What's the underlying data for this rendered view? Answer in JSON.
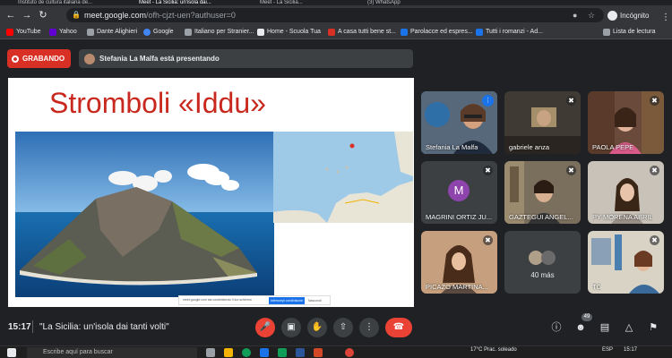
{
  "browser": {
    "tabs": [
      "Instituto de cultura italiana de...",
      "Meet - La Sicilia: un'isola dai...",
      "Meet - La Sicilia...",
      "(3) WhatsApp"
    ],
    "url_host": "meet.google.com",
    "url_path": "/ofh-cjzt-uen?authuser=0",
    "incognito_label": "Incógnito",
    "bookmarks": [
      {
        "label": "YouTube",
        "color": "#ff0000"
      },
      {
        "label": "Yahoo",
        "color": "#6001d2"
      },
      {
        "label": "Dante Alighieri",
        "color": "#9aa0a6"
      },
      {
        "label": "Google",
        "color": "#4285f4"
      },
      {
        "label": "Italiano per Stranier...",
        "color": "#9aa0a6"
      },
      {
        "label": "Home - Scuola Tua",
        "color": "#e8eaed"
      },
      {
        "label": "A casa tutti bene st...",
        "color": "#d93025"
      },
      {
        "label": "Parolacce ed espres...",
        "color": "#1a73e8"
      },
      {
        "label": "Tutti i romanzi - Ad...",
        "color": "#1a73e8"
      }
    ],
    "reading_list": "Lista de lectura"
  },
  "meet": {
    "recording_label": "GRABANDO",
    "presenter_text": "Stefania La Malfa está presentando",
    "slide": {
      "title": "Stromboli «Iddu»",
      "cookie_text": "meet.google.com sta condividendo il tuo schermo",
      "cookie_button": "Interrompi condivisione",
      "cookie_hide": "Nascondi"
    },
    "participants": [
      {
        "name": "Stefania La Malfa",
        "mic": "speaking"
      },
      {
        "name": "gabriele anza",
        "mic": "off"
      },
      {
        "name": "PAOLA PEPE",
        "mic": "off"
      },
      {
        "name": "MAGRINI ORTIZ JU...",
        "mic": "off",
        "initial": "M",
        "avatar_color": "#8e44ad"
      },
      {
        "name": "GAZTEGUI ANGEL...",
        "mic": "off"
      },
      {
        "name": "PY MORENA ABRIL",
        "mic": "off"
      },
      {
        "name": "PICAZO MARTINA...",
        "mic": "off"
      },
      {
        "name": "TG",
        "mic": "off"
      }
    ],
    "more_label": "40 más",
    "time": "15:17",
    "meeting_title": "\"La Sicilia: un'isola dai tanti volti\"",
    "participant_count": "49"
  },
  "taskbar": {
    "search_placeholder": "Escribe aquí para buscar",
    "weather": "17°C  Prac. soleado",
    "lang": "ESP",
    "clock_time": "15:17"
  },
  "colors": {
    "accent": "#1a73e8",
    "danger": "#ea4335",
    "title_red": "#c8281e"
  }
}
